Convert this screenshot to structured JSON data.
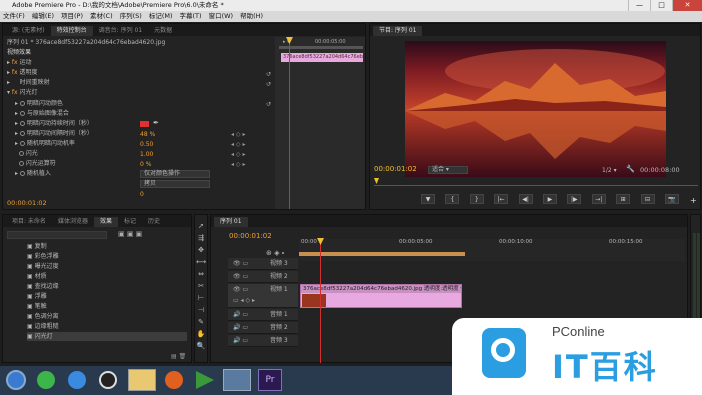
{
  "app_title": "Adobe Premiere Pro - D:\\我的文档\\Adobe\\Premiere Pro\\6.0\\未命名 *",
  "window_buttons": [
    "—",
    "□",
    "✕"
  ],
  "menu": [
    "文件(F)",
    "编辑(E)",
    "项目(P)",
    "素材(C)",
    "序列(S)",
    "标记(M)",
    "字幕(T)",
    "窗口(W)",
    "帮助(H)"
  ],
  "source_tabs": [
    "源: (无素材)",
    "特效控制台",
    "调音台: 序列 01",
    "元数据"
  ],
  "effect_controls": {
    "clip_header": "序列 01 * 376ace8df53227a204d64c76ebad4620.jpg",
    "section_label": "视频效果",
    "ruler_time": "00:00:05:00",
    "clip_chip": "376ace8df53227a204d64c76ebad4620.jpg",
    "effects": [
      {
        "label": "运动",
        "icon": "fx"
      },
      {
        "label": "透明度",
        "icon": "fx"
      },
      {
        "label": "时间重映射",
        "icon": ""
      },
      {
        "label": "闪光灯",
        "icon": "fx"
      }
    ],
    "params": [
      {
        "label": "明暗闪动颜色",
        "value": ""
      },
      {
        "label": "与原始图像混合",
        "value": "48 %"
      },
      {
        "label": "明暗闪动持续时间（秒）",
        "value": "0.50"
      },
      {
        "label": "明暗闪动间隔时间（秒）",
        "value": "1.00"
      },
      {
        "label": "随机明暗闪动机率",
        "value": "0 %"
      },
      {
        "label": "闪光",
        "value": "仅对颜色操作"
      },
      {
        "label": "闪光运算符",
        "value": "拷贝"
      },
      {
        "label": "随机植入",
        "value": "0"
      }
    ],
    "current_time": "00:00:01:02"
  },
  "program": {
    "tab": "节目: 序列 01",
    "timecode_left": "00:00:01:02",
    "fit_label": "适合",
    "fraction": "1/2",
    "timecode_right": "00:00:08:00"
  },
  "transport_buttons": [
    "▼",
    "{",
    "}",
    "|←",
    "◀|",
    "▶",
    "|▶",
    "→|",
    "⊞",
    "⊟",
    "📷"
  ],
  "project": {
    "tabs": [
      "项目: 未命名",
      "媒体浏览器",
      "效果",
      "标记",
      "历史"
    ],
    "items": [
      "复制",
      "彩色浮雕",
      "曝光过度",
      "材质",
      "查找边缘",
      "浮雕",
      "笔触",
      "色调分离",
      "边缘粗糙",
      "闪光灯"
    ]
  },
  "timeline": {
    "tab": "序列 01",
    "timecode": "00:00:01:02",
    "ruler_labels": [
      "00:00",
      "00:00:05:00",
      "00:00:10:00",
      "00:00:15:00"
    ],
    "tracks": [
      {
        "label": "视频 3",
        "kind": "video"
      },
      {
        "label": "视频 2",
        "kind": "video"
      },
      {
        "label": "视频 1",
        "kind": "video"
      },
      {
        "label": "音频 1",
        "kind": "audio"
      },
      {
        "label": "音频 2",
        "kind": "audio"
      },
      {
        "label": "音频 3",
        "kind": "audio"
      }
    ],
    "clip_label": "376ace8df53227a204d64c76ebad4620.jpg 透明度:透明度 ▾"
  },
  "watermark": {
    "brand": "PConline",
    "slogan": "IT百科"
  },
  "colors": {
    "accent_orange": "#f0a030",
    "clip_pink": "#e8a8e0",
    "playhead_red": "#d03030",
    "timecode_yellow": "#f0c030"
  }
}
